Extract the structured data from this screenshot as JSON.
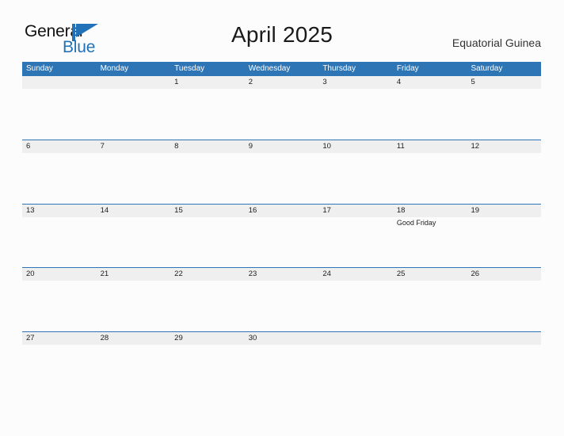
{
  "brand": {
    "word_one": "General",
    "word_two": "Blue",
    "mark": "triangle-flag-icon",
    "black": "#111111",
    "blue": "#2272b8"
  },
  "header": {
    "title": "April 2025",
    "subtitle": "Equatorial Guinea"
  },
  "theme": {
    "header_blue": "#2e75b6",
    "band_gray": "#efefef",
    "page_background": "#fcfcfc",
    "text": "#1c1c1c"
  },
  "calendar": {
    "weekdays": [
      "Sunday",
      "Monday",
      "Tuesday",
      "Wednesday",
      "Thursday",
      "Friday",
      "Saturday"
    ],
    "weeks": [
      {
        "days": [
          {
            "num": "",
            "events": []
          },
          {
            "num": "",
            "events": []
          },
          {
            "num": "1",
            "events": []
          },
          {
            "num": "2",
            "events": []
          },
          {
            "num": "3",
            "events": []
          },
          {
            "num": "4",
            "events": []
          },
          {
            "num": "5",
            "events": []
          }
        ]
      },
      {
        "days": [
          {
            "num": "6",
            "events": []
          },
          {
            "num": "7",
            "events": []
          },
          {
            "num": "8",
            "events": []
          },
          {
            "num": "9",
            "events": []
          },
          {
            "num": "10",
            "events": []
          },
          {
            "num": "11",
            "events": []
          },
          {
            "num": "12",
            "events": []
          }
        ]
      },
      {
        "days": [
          {
            "num": "13",
            "events": []
          },
          {
            "num": "14",
            "events": []
          },
          {
            "num": "15",
            "events": []
          },
          {
            "num": "16",
            "events": []
          },
          {
            "num": "17",
            "events": []
          },
          {
            "num": "18",
            "events": [
              "Good Friday"
            ]
          },
          {
            "num": "19",
            "events": []
          }
        ]
      },
      {
        "days": [
          {
            "num": "20",
            "events": []
          },
          {
            "num": "21",
            "events": []
          },
          {
            "num": "22",
            "events": []
          },
          {
            "num": "23",
            "events": []
          },
          {
            "num": "24",
            "events": []
          },
          {
            "num": "25",
            "events": []
          },
          {
            "num": "26",
            "events": []
          }
        ]
      },
      {
        "days": [
          {
            "num": "27",
            "events": []
          },
          {
            "num": "28",
            "events": []
          },
          {
            "num": "29",
            "events": []
          },
          {
            "num": "30",
            "events": []
          },
          {
            "num": "",
            "events": []
          },
          {
            "num": "",
            "events": []
          },
          {
            "num": "",
            "events": []
          }
        ]
      }
    ]
  }
}
